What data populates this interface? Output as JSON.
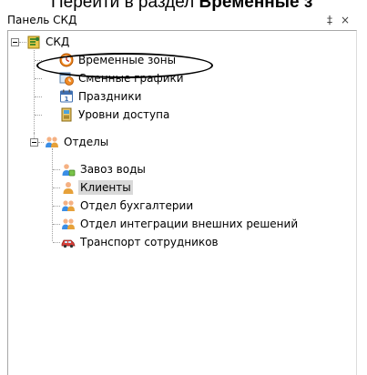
{
  "instruction": {
    "prefix": "Перейти в раздел ",
    "bold": "Временные з"
  },
  "panel": {
    "title": "Панель СКД",
    "pin_glyph": "‡",
    "close_glyph": "×"
  },
  "tree": {
    "root": {
      "label": "СКД",
      "icon": "acs-folder-icon"
    },
    "items": [
      {
        "label": "Временные зоны",
        "icon": "clock-icon"
      },
      {
        "label": "Сменные графики",
        "icon": "shift-schedule-icon"
      },
      {
        "label": "Праздники",
        "icon": "calendar-icon"
      },
      {
        "label": "Уровни доступа",
        "icon": "access-level-icon"
      }
    ],
    "departments": {
      "label": "Отделы",
      "icon": "people-group-icon",
      "children": [
        {
          "label": "Завоз воды",
          "icon": "water-delivery-icon"
        },
        {
          "label": "Клиенты",
          "icon": "person-icon",
          "selected": true
        },
        {
          "label": "Отдел бухгалтерии",
          "icon": "people-group-icon"
        },
        {
          "label": "Отдел интеграции внешних решений",
          "icon": "people-group-icon"
        },
        {
          "label": "Транспорт сотрудников",
          "icon": "vehicle-icon"
        }
      ]
    }
  }
}
